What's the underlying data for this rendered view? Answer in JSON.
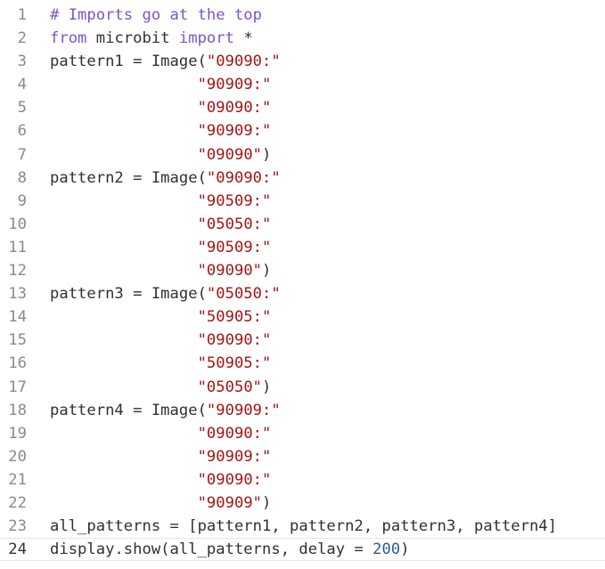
{
  "editor": {
    "colors": {
      "background": "#ffffff",
      "line_number": "#8a8a8a",
      "current_line_number": "#333333",
      "comment": "#7c54c8",
      "keyword": "#7c54c8",
      "string": "#a31515",
      "number": "#2a5c91",
      "plain": "#303030"
    },
    "current_line": 24,
    "lines": [
      {
        "number": "1",
        "tokens": [
          {
            "t": "comment",
            "v": "# Imports go at the top"
          }
        ]
      },
      {
        "number": "2",
        "tokens": [
          {
            "t": "keyword",
            "v": "from"
          },
          {
            "t": "plain",
            "v": " microbit "
          },
          {
            "t": "keyword",
            "v": "import"
          },
          {
            "t": "plain",
            "v": " *"
          }
        ]
      },
      {
        "number": "3",
        "tokens": [
          {
            "t": "plain",
            "v": "pattern1 = Image("
          },
          {
            "t": "string",
            "v": "\"09090:\""
          }
        ]
      },
      {
        "number": "4",
        "tokens": [
          {
            "t": "plain",
            "v": "                "
          },
          {
            "t": "string",
            "v": "\"90909:\""
          }
        ]
      },
      {
        "number": "5",
        "tokens": [
          {
            "t": "plain",
            "v": "                "
          },
          {
            "t": "string",
            "v": "\"09090:\""
          }
        ]
      },
      {
        "number": "6",
        "tokens": [
          {
            "t": "plain",
            "v": "                "
          },
          {
            "t": "string",
            "v": "\"90909:\""
          }
        ]
      },
      {
        "number": "7",
        "tokens": [
          {
            "t": "plain",
            "v": "                "
          },
          {
            "t": "string",
            "v": "\"09090\""
          },
          {
            "t": "plain",
            "v": ")"
          }
        ]
      },
      {
        "number": "8",
        "tokens": [
          {
            "t": "plain",
            "v": "pattern2 = Image("
          },
          {
            "t": "string",
            "v": "\"09090:\""
          }
        ]
      },
      {
        "number": "9",
        "tokens": [
          {
            "t": "plain",
            "v": "                "
          },
          {
            "t": "string",
            "v": "\"90509:\""
          }
        ]
      },
      {
        "number": "10",
        "tokens": [
          {
            "t": "plain",
            "v": "                "
          },
          {
            "t": "string",
            "v": "\"05050:\""
          }
        ]
      },
      {
        "number": "11",
        "tokens": [
          {
            "t": "plain",
            "v": "                "
          },
          {
            "t": "string",
            "v": "\"90509:\""
          }
        ]
      },
      {
        "number": "12",
        "tokens": [
          {
            "t": "plain",
            "v": "                "
          },
          {
            "t": "string",
            "v": "\"09090\""
          },
          {
            "t": "plain",
            "v": ")"
          }
        ]
      },
      {
        "number": "13",
        "tokens": [
          {
            "t": "plain",
            "v": "pattern3 = Image("
          },
          {
            "t": "string",
            "v": "\"05050:\""
          }
        ]
      },
      {
        "number": "14",
        "tokens": [
          {
            "t": "plain",
            "v": "                "
          },
          {
            "t": "string",
            "v": "\"50905:\""
          }
        ]
      },
      {
        "number": "15",
        "tokens": [
          {
            "t": "plain",
            "v": "                "
          },
          {
            "t": "string",
            "v": "\"09090:\""
          }
        ]
      },
      {
        "number": "16",
        "tokens": [
          {
            "t": "plain",
            "v": "                "
          },
          {
            "t": "string",
            "v": "\"50905:\""
          }
        ]
      },
      {
        "number": "17",
        "tokens": [
          {
            "t": "plain",
            "v": "                "
          },
          {
            "t": "string",
            "v": "\"05050\""
          },
          {
            "t": "plain",
            "v": ")"
          }
        ]
      },
      {
        "number": "18",
        "tokens": [
          {
            "t": "plain",
            "v": "pattern4 = Image("
          },
          {
            "t": "string",
            "v": "\"90909:\""
          }
        ]
      },
      {
        "number": "19",
        "tokens": [
          {
            "t": "plain",
            "v": "                "
          },
          {
            "t": "string",
            "v": "\"09090:\""
          }
        ]
      },
      {
        "number": "20",
        "tokens": [
          {
            "t": "plain",
            "v": "                "
          },
          {
            "t": "string",
            "v": "\"90909:\""
          }
        ]
      },
      {
        "number": "21",
        "tokens": [
          {
            "t": "plain",
            "v": "                "
          },
          {
            "t": "string",
            "v": "\"09090:\""
          }
        ]
      },
      {
        "number": "22",
        "tokens": [
          {
            "t": "plain",
            "v": "                "
          },
          {
            "t": "string",
            "v": "\"90909\""
          },
          {
            "t": "plain",
            "v": ")"
          }
        ]
      },
      {
        "number": "23",
        "tokens": [
          {
            "t": "plain",
            "v": "all_patterns = [pattern1, pattern2, pattern3, pattern4]"
          }
        ]
      },
      {
        "number": "24",
        "tokens": [
          {
            "t": "plain",
            "v": "display.show(all_patterns, delay = "
          },
          {
            "t": "number",
            "v": "200"
          },
          {
            "t": "plain",
            "v": ")"
          }
        ]
      }
    ]
  }
}
